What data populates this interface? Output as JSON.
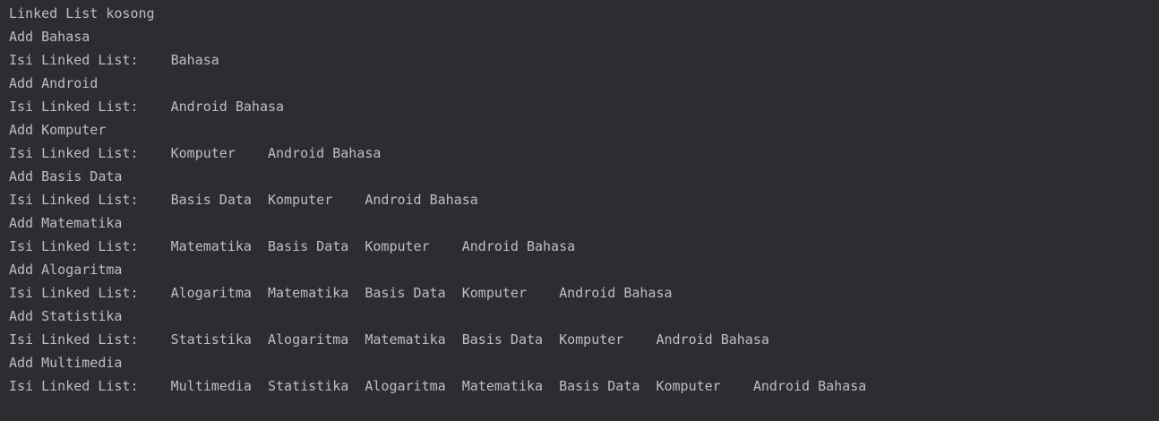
{
  "console": {
    "lines": [
      "Linked List kosong",
      "Add Bahasa",
      "Isi Linked List:    Bahasa",
      "Add Android",
      "Isi Linked List:    Android Bahasa",
      "Add Komputer",
      "Isi Linked List:    Komputer    Android Bahasa",
      "Add Basis Data",
      "Isi Linked List:    Basis Data  Komputer    Android Bahasa",
      "Add Matematika",
      "Isi Linked List:    Matematika  Basis Data  Komputer    Android Bahasa",
      "Add Alogaritma",
      "Isi Linked List:    Alogaritma  Matematika  Basis Data  Komputer    Android Bahasa",
      "Add Statistika",
      "Isi Linked List:    Statistika  Alogaritma  Matematika  Basis Data  Komputer    Android Bahasa",
      "Add Multimedia",
      "Isi Linked List:    Multimedia  Statistika  Alogaritma  Matematika  Basis Data  Komputer    Android Bahasa"
    ]
  },
  "colors": {
    "background": "#2b2d30",
    "text": "#bcbec4"
  }
}
